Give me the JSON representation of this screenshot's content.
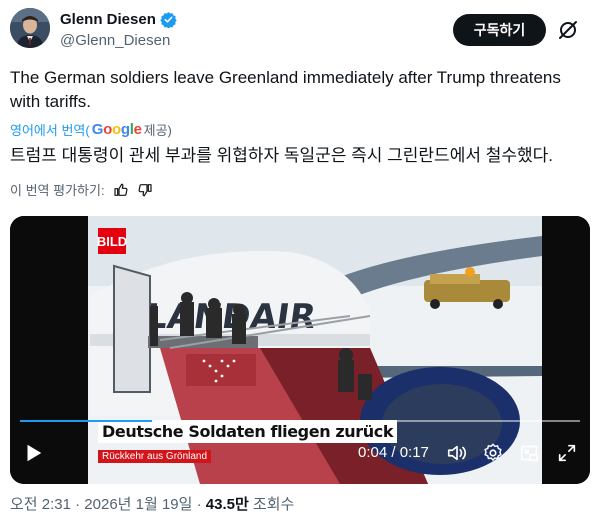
{
  "author": {
    "name": "Glenn Diesen",
    "handle": "@Glenn_Diesen",
    "verified_color": "#1d9bf0"
  },
  "header": {
    "subscribe_label": "구독하기",
    "grok_icon": "grok-slash-circle-icon"
  },
  "tweet": {
    "text": "The German soldiers leave Greenland immediately after Trump threatens with tariffs.",
    "translate_label": "영어에서 번역(",
    "translate_provider_letters": [
      "G",
      "o",
      "o",
      "g",
      "l",
      "e"
    ],
    "translate_provider_suffix": "제공)",
    "translated_text": "트럼프 대통령이 관세 부과를 위협하자 독일군은 즉시 그린란드에서 철수했다.",
    "rate_label": "이 번역 평가하기:",
    "rate_icons": [
      "thumbs-up-icon",
      "thumbs-down-icon"
    ]
  },
  "video": {
    "overlay_logo": "BILD",
    "headline": "Deutsche Soldaten fliegen zurück",
    "subline": "Rückkehr aus Grönland",
    "time": "0:04 / 0:17",
    "progress": 0.235,
    "controls": [
      "play-icon",
      "volume-icon",
      "settings-gear-icon",
      "pip-icon",
      "fullscreen-icon"
    ],
    "accent_color": "#1d9bf0"
  },
  "meta": {
    "timestamp": "오전 2:31 · 2026년 1월 19일 · ",
    "views_count": "43.5만",
    "views_label": " 조회수"
  }
}
